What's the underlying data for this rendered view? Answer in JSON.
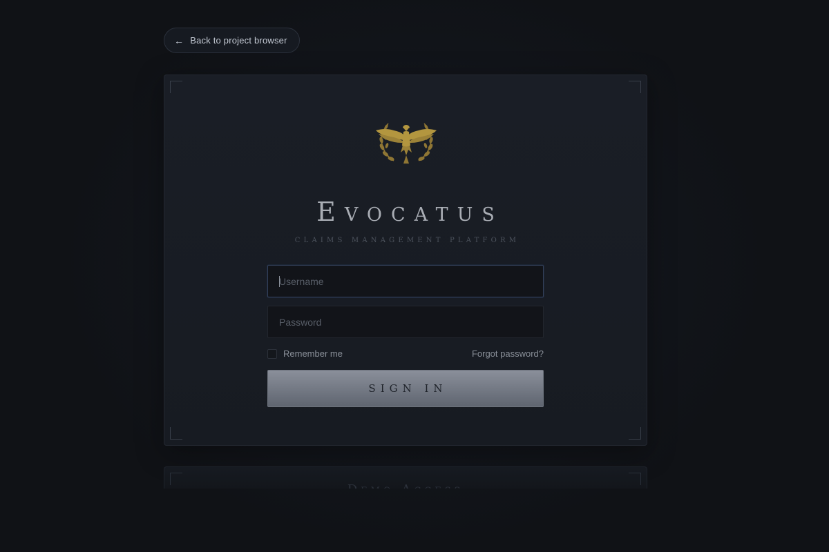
{
  "nav": {
    "back_arrow": "←",
    "back_label": "Back to project browser"
  },
  "brand": {
    "name": "Evocatus",
    "tagline": "Claims Management Platform",
    "logo_icon": "eagle-laurel-emblem",
    "logo_color": "#a48a3e"
  },
  "form": {
    "username_placeholder": "Username",
    "password_placeholder": "Password",
    "remember_label": "Remember me",
    "remember_checked": false,
    "forgot_label": "Forgot password?",
    "submit_label": "SIGN IN"
  },
  "demo": {
    "title": "Demo Access"
  },
  "colors": {
    "background": "#111318",
    "card": "#1a1e26",
    "button": "#7a808b",
    "gold": "#a48a3e"
  }
}
